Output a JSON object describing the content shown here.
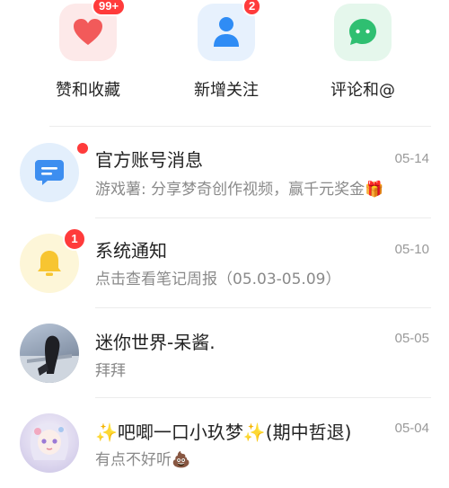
{
  "top_tiles": [
    {
      "label": "赞和收藏",
      "badge": "99+",
      "icon": "heart-icon"
    },
    {
      "label": "新增关注",
      "badge": "2",
      "icon": "person-icon"
    },
    {
      "label": "评论和@",
      "badge": "",
      "icon": "chat-bubble-icon"
    }
  ],
  "messages": [
    {
      "name": "官方账号消息",
      "preview": "游戏薯: 分享梦奇创作视频，赢千元奖金🎁",
      "time": "05-14",
      "badge": "dot"
    },
    {
      "name": "系统通知",
      "preview": "点击查看笔记周报（05.03-05.09）",
      "time": "05-10",
      "badge": "1"
    },
    {
      "name": "迷你世界-呆酱.",
      "preview": "拜拜",
      "time": "05-05",
      "badge": ""
    },
    {
      "name": "✨吧唧一口小玖梦✨(期中哲退)",
      "preview": "有点不好听💩",
      "time": "05-04",
      "badge": ""
    }
  ],
  "colors": {
    "badge": "#ff3b3b",
    "heart": "#f25a5a",
    "person": "#2f8cf5",
    "chat": "#2fbf71",
    "bell": "#f7c531"
  }
}
